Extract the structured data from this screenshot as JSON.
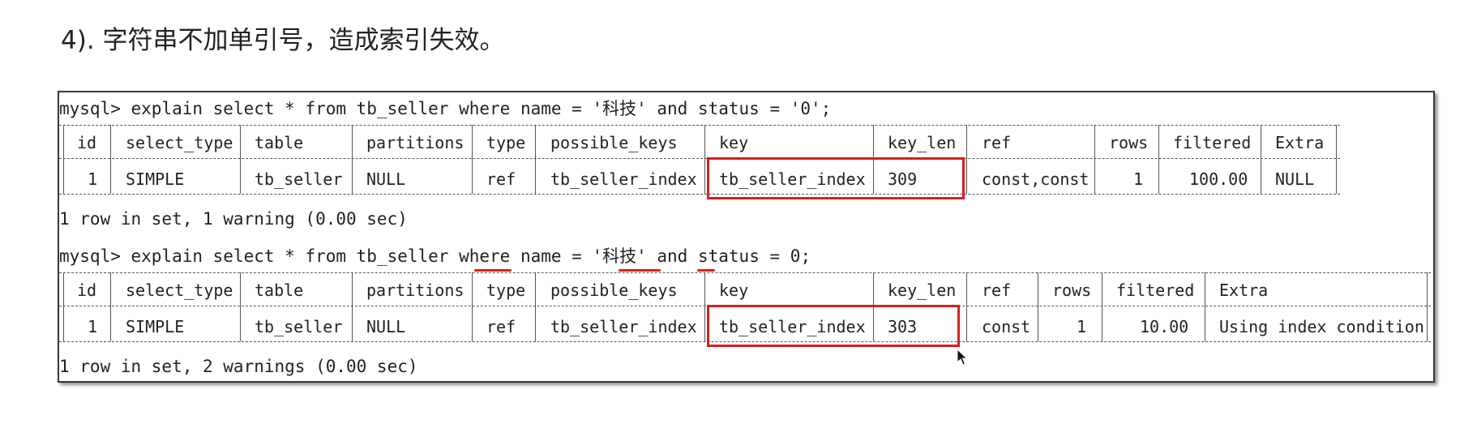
{
  "heading": "4). 字符串不加单引号，造成索引失效。",
  "query1": {
    "prompt": "mysql> ",
    "sql": "explain select * from tb_seller where name = '科技' and status = '0';",
    "headers": [
      "id",
      "select_type",
      "table",
      "partitions",
      "type",
      "possible_keys",
      "key",
      "key_len",
      "ref",
      "rows",
      "filtered",
      "Extra"
    ],
    "row": [
      "1",
      "SIMPLE",
      "tb_seller",
      "NULL",
      "ref",
      "tb_seller_index",
      "tb_seller_index",
      "309",
      "const,const",
      "1",
      "100.00",
      "NULL"
    ],
    "result": "1 row in set, 1 warning (0.00 sec)"
  },
  "query2": {
    "prompt": "mysql> ",
    "sql_parts": [
      "explain select * from tb_seller where ",
      "name",
      " = '科技' ",
      "and",
      " ",
      "status",
      " = ",
      "0",
      ";"
    ],
    "headers": [
      "id",
      "select_type",
      "table",
      "partitions",
      "type",
      "possible_keys",
      "key",
      "key_len",
      "ref",
      "rows",
      "filtered",
      "Extra"
    ],
    "row": [
      "1",
      "SIMPLE",
      "tb_seller",
      "NULL",
      "ref",
      "tb_seller_index",
      "tb_seller_index",
      "303",
      "const",
      "1",
      "10.00",
      "Using index condition"
    ],
    "result": "1 row in set, 2 warnings (0.00 sec)"
  },
  "highlight_color": "#d42020"
}
